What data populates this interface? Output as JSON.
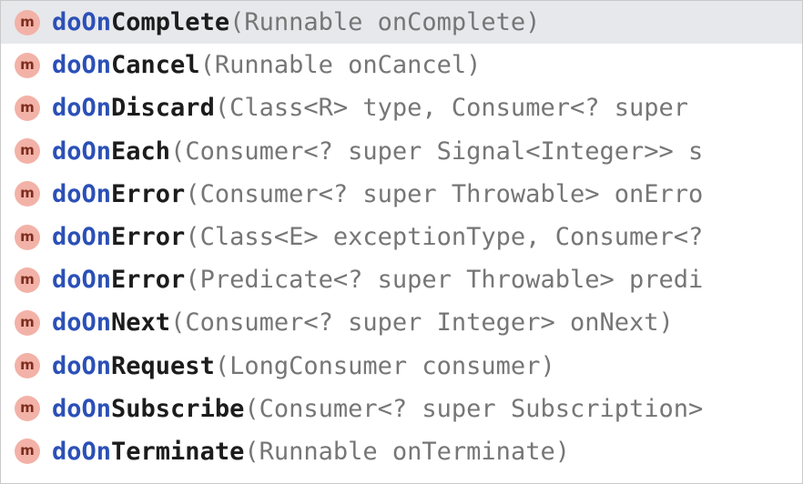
{
  "completion": {
    "typed_prefix": "doOn",
    "items": [
      {
        "icon": "method-icon",
        "icon_letter": "m",
        "prefix": "doOn",
        "suffix": "Complete",
        "params": "(Runnable onComplete)",
        "selected": true
      },
      {
        "icon": "method-icon",
        "icon_letter": "m",
        "prefix": "doOn",
        "suffix": "Cancel",
        "params": "(Runnable onCancel)",
        "selected": false
      },
      {
        "icon": "method-icon",
        "icon_letter": "m",
        "prefix": "doOn",
        "suffix": "Discard",
        "params": "(Class<R> type, Consumer<? super",
        "selected": false
      },
      {
        "icon": "method-icon",
        "icon_letter": "m",
        "prefix": "doOn",
        "suffix": "Each",
        "params": "(Consumer<? super Signal<Integer>> s",
        "selected": false
      },
      {
        "icon": "method-icon",
        "icon_letter": "m",
        "prefix": "doOn",
        "suffix": "Error",
        "params": "(Consumer<? super Throwable> onErro",
        "selected": false
      },
      {
        "icon": "method-icon",
        "icon_letter": "m",
        "prefix": "doOn",
        "suffix": "Error",
        "params": "(Class<E> exceptionType, Consumer<?",
        "selected": false
      },
      {
        "icon": "method-icon",
        "icon_letter": "m",
        "prefix": "doOn",
        "suffix": "Error",
        "params": "(Predicate<? super Throwable> predi",
        "selected": false
      },
      {
        "icon": "method-icon",
        "icon_letter": "m",
        "prefix": "doOn",
        "suffix": "Next",
        "params": "(Consumer<? super Integer> onNext)",
        "selected": false
      },
      {
        "icon": "method-icon",
        "icon_letter": "m",
        "prefix": "doOn",
        "suffix": "Request",
        "params": "(LongConsumer consumer)",
        "selected": false
      },
      {
        "icon": "method-icon",
        "icon_letter": "m",
        "prefix": "doOn",
        "suffix": "Subscribe",
        "params": "(Consumer<? super Subscription>",
        "selected": false
      },
      {
        "icon": "method-icon",
        "icon_letter": "m",
        "prefix": "doOn",
        "suffix": "Terminate",
        "params": "(Runnable onTerminate)",
        "selected": false
      }
    ]
  },
  "colors": {
    "selection_bg": "#e7e8ec",
    "match_text": "#2b50b7",
    "method_name": "#1c1c1c",
    "params_text": "#767676",
    "method_icon_bg": "#f3b2a7"
  }
}
